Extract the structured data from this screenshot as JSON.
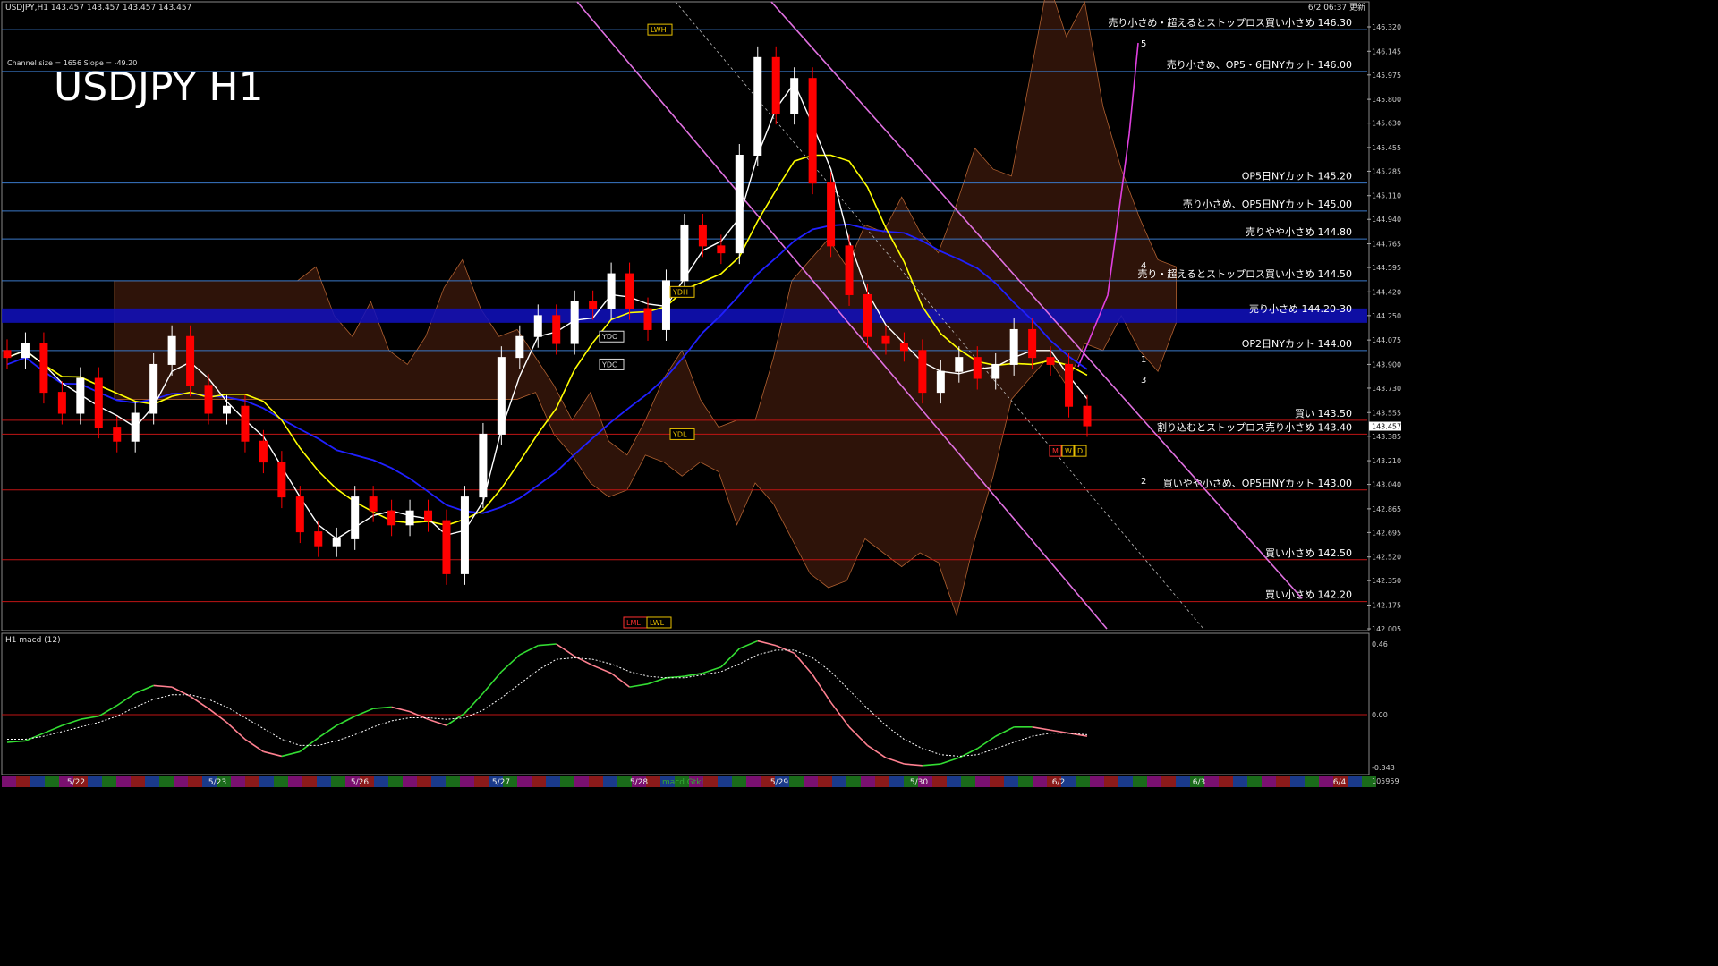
{
  "header": {
    "symbol_info": "USDJPY,H1  143.457 143.457 143.457 143.457",
    "updated": "6/2 06:37 更新",
    "channel_info": "Channel size = 1656 Slope = -49.20",
    "big_title": "USDJPY H1"
  },
  "colors": {
    "background": "#000000",
    "bull_candle": "#ffffff",
    "bear_candle": "#ff0000",
    "resistance_line": "#3a78c8",
    "support_line": "#c01414",
    "band_zone": "#1010c0",
    "sma_short": "#ffffff",
    "sma_mid": "#ffff00",
    "sma_long": "#2020ff",
    "kumo": "#ff6a30",
    "channel": "#e070e0",
    "macd_up": "#33dd33",
    "macd_down": "#ff8090",
    "signal": "#ffffff"
  },
  "chart_data": {
    "type": "candlestick",
    "title": "USDJPY H1",
    "ylim": [
      142.005,
      146.32
    ],
    "y_ticks": [
      "146.320",
      "146.145",
      "145.975",
      "145.800",
      "145.630",
      "145.455",
      "145.285",
      "145.110",
      "144.940",
      "144.765",
      "144.595",
      "144.420",
      "144.250",
      "144.075",
      "143.900",
      "143.730",
      "143.555",
      "143.385",
      "143.210",
      "143.040",
      "142.865",
      "142.695",
      "142.520",
      "142.350",
      "142.175",
      "142.005"
    ],
    "current_price_label": "143.457",
    "x_ticks": [
      "5/22",
      "5/23",
      "5/26",
      "5/27",
      "5/28",
      "5/29",
      "5/30",
      "6/2",
      "6/3",
      "6/4"
    ],
    "ohlc_close_path": [
      143.95,
      144.05,
      143.7,
      143.55,
      143.8,
      143.45,
      143.35,
      143.55,
      143.9,
      144.1,
      143.75,
      143.55,
      143.6,
      143.35,
      143.2,
      142.95,
      142.7,
      142.6,
      142.65,
      142.95,
      142.85,
      142.75,
      142.85,
      142.78,
      142.4,
      142.95,
      143.4,
      143.95,
      144.1,
      144.25,
      144.05,
      144.35,
      144.3,
      144.55,
      144.3,
      144.15,
      144.5,
      144.9,
      144.75,
      144.7,
      145.4,
      146.1,
      145.7,
      145.95,
      145.2,
      144.75,
      144.4,
      144.1,
      144.05,
      144.0,
      143.7,
      143.85,
      143.95,
      143.8,
      143.9,
      144.15,
      143.95,
      143.9,
      143.6,
      143.46
    ],
    "levels": [
      {
        "label": "売り小さめ・超えるとストップロス買い小さめ 146.30",
        "price": 146.3,
        "kind": "resist"
      },
      {
        "label": "売り小さめ、OP5・6日NYカット 146.00",
        "price": 146.0,
        "kind": "resist"
      },
      {
        "label": "OP5日NYカット 145.20",
        "price": 145.2,
        "kind": "resist"
      },
      {
        "label": "売り小さめ、OP5日NYカット 145.00",
        "price": 145.0,
        "kind": "resist"
      },
      {
        "label": "売りやや小さめ 144.80",
        "price": 144.8,
        "kind": "resist"
      },
      {
        "label": "売り・超えるとストップロス買い小さめ 144.50",
        "price": 144.5,
        "kind": "resist"
      },
      {
        "label": "売り小さめ 144.20-30",
        "price": 144.25,
        "kind": "zone"
      },
      {
        "label": "OP2日NYカット 144.00",
        "price": 144.0,
        "kind": "resist"
      },
      {
        "label": "買い 143.50",
        "price": 143.5,
        "kind": "support"
      },
      {
        "label": "割り込むとストップロス売り小さめ 143.40",
        "price": 143.4,
        "kind": "support"
      },
      {
        "label": "買いやや小さめ、OP5日NYカット 143.00",
        "price": 143.0,
        "kind": "support"
      },
      {
        "label": "買い小さめ 142.50",
        "price": 142.5,
        "kind": "support"
      },
      {
        "label": "買い小さめ 142.20",
        "price": 142.2,
        "kind": "support"
      }
    ],
    "tags": [
      "LWH",
      "YDH",
      "YDO",
      "YDC",
      "YDL",
      "LML",
      "LWL",
      "M",
      "W",
      "D"
    ],
    "wave_labels": [
      "5",
      "4",
      "1",
      "3",
      "2"
    ],
    "macd": {
      "label": "H1  macd (12)",
      "y_ticks": [
        "0.46",
        "0.00",
        "-0.343"
      ],
      "footer_value": "105959",
      "legend_text": "macd Gtkl",
      "macd_path": [
        -0.18,
        -0.17,
        -0.12,
        -0.07,
        -0.03,
        -0.01,
        0.06,
        0.14,
        0.19,
        0.18,
        0.12,
        0.04,
        -0.05,
        -0.16,
        -0.24,
        -0.27,
        -0.24,
        -0.15,
        -0.07,
        -0.01,
        0.04,
        0.05,
        0.02,
        -0.03,
        -0.07,
        0.01,
        0.14,
        0.28,
        0.39,
        0.45,
        0.46,
        0.38,
        0.32,
        0.27,
        0.18,
        0.2,
        0.24,
        0.25,
        0.27,
        0.31,
        0.43,
        0.48,
        0.45,
        0.4,
        0.26,
        0.08,
        -0.08,
        -0.2,
        -0.28,
        -0.32,
        -0.33,
        -0.32,
        -0.28,
        -0.22,
        -0.14,
        -0.08,
        -0.08,
        -0.1,
        -0.12,
        -0.14
      ],
      "signal_path": [
        -0.16,
        -0.16,
        -0.14,
        -0.11,
        -0.08,
        -0.05,
        -0.01,
        0.05,
        0.1,
        0.13,
        0.13,
        0.1,
        0.05,
        -0.02,
        -0.09,
        -0.16,
        -0.2,
        -0.2,
        -0.17,
        -0.13,
        -0.08,
        -0.04,
        -0.02,
        -0.02,
        -0.03,
        -0.02,
        0.03,
        0.11,
        0.2,
        0.29,
        0.36,
        0.37,
        0.36,
        0.33,
        0.28,
        0.25,
        0.24,
        0.24,
        0.26,
        0.28,
        0.33,
        0.39,
        0.42,
        0.42,
        0.37,
        0.28,
        0.16,
        0.04,
        -0.07,
        -0.16,
        -0.22,
        -0.26,
        -0.27,
        -0.26,
        -0.22,
        -0.18,
        -0.14,
        -0.12,
        -0.12,
        -0.13
      ]
    }
  }
}
